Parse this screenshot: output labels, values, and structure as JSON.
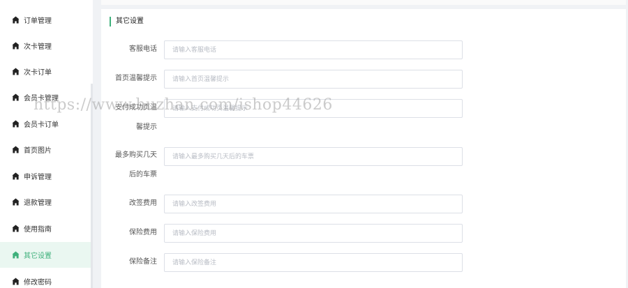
{
  "sidebar": {
    "items": [
      {
        "label": "订单管理",
        "active": false
      },
      {
        "label": "次卡管理",
        "active": false
      },
      {
        "label": "次卡订单",
        "active": false
      },
      {
        "label": "会员卡管理",
        "active": false
      },
      {
        "label": "会员卡订单",
        "active": false
      },
      {
        "label": "首页图片",
        "active": false
      },
      {
        "label": "申诉管理",
        "active": false
      },
      {
        "label": "退款管理",
        "active": false
      },
      {
        "label": "使用指南",
        "active": false
      },
      {
        "label": "其它设置",
        "active": true
      },
      {
        "label": "修改密码",
        "active": false
      }
    ]
  },
  "section": {
    "title": "其它设置"
  },
  "form": {
    "service_phone": {
      "label": "客服电话",
      "placeholder": "请输入客服电话",
      "value": ""
    },
    "home_tip": {
      "label": "首页温馨提示",
      "placeholder": "请输入首页温馨提示",
      "value": ""
    },
    "checkout_tip": {
      "label_line1": "支付成功页温",
      "label_line2": "馨提示",
      "placeholder": "请输入支付成功页温馨提示",
      "value": ""
    },
    "max_days": {
      "label_line1": "最多购买几天",
      "label_line2": "后的车票",
      "placeholder": "请输入最多购买几天后的车票",
      "value": ""
    },
    "change_fee": {
      "label": "改签费用",
      "placeholder": "请输入改签费用",
      "value": ""
    },
    "insurance_fee": {
      "label": "保险费用",
      "placeholder": "请输入保险费用",
      "value": ""
    },
    "insurance_note": {
      "label": "保险备注",
      "placeholder": "请输入保险备注",
      "value": ""
    }
  },
  "watermark": {
    "text": "https://www.huzhan.com/ishop44626"
  },
  "colors": {
    "accent": "#3eb07b",
    "active_bg": "#eaf7f1",
    "border": "#dcdfe6"
  },
  "icons": {
    "nav_icon": "home-icon"
  }
}
